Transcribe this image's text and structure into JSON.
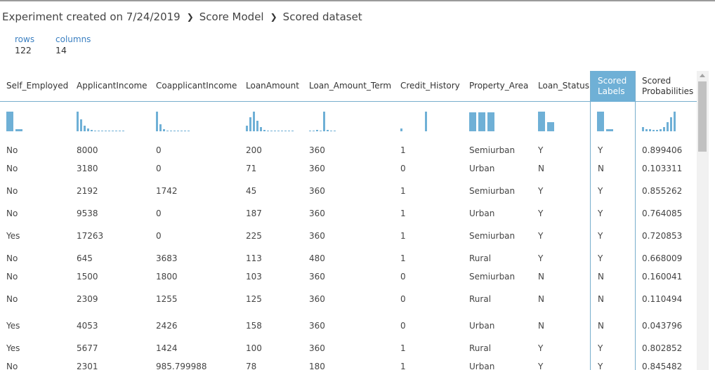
{
  "breadcrumb": {
    "items": [
      "Experiment created on 7/24/2019",
      "Score Model",
      "Scored dataset"
    ],
    "separator_icon": "chevron-right-icon"
  },
  "stats": {
    "rows_label": "rows",
    "rows_value": "122",
    "columns_label": "columns",
    "columns_value": "14"
  },
  "colors": {
    "bar": "#6fb0d6",
    "header_accent": "#78aecd",
    "link": "#3a7fc1"
  },
  "table": {
    "columns": [
      {
        "key": "self_employed",
        "label": "Self_Employed"
      },
      {
        "key": "applicant_income",
        "label": "ApplicantIncome"
      },
      {
        "key": "coapplicant_income",
        "label": "CoapplicantIncome"
      },
      {
        "key": "loan_amount",
        "label": "LoanAmount"
      },
      {
        "key": "loan_amount_term",
        "label": "Loan_Amount_Term"
      },
      {
        "key": "credit_history",
        "label": "Credit_History"
      },
      {
        "key": "property_area",
        "label": "Property_Area"
      },
      {
        "key": "loan_status",
        "label": "Loan_Status"
      },
      {
        "key": "scored_labels",
        "label": "Scored Labels",
        "selected": true
      },
      {
        "key": "scored_probabilities",
        "label": "Scored Probabilities"
      }
    ],
    "histograms": {
      "self_employed": [
        1.0,
        0.12
      ],
      "applicant_income": [
        1.0,
        0.6,
        0.3,
        0.15,
        0.08,
        0.05,
        0.04,
        0.03,
        0.03,
        0.02,
        0.02,
        0.02,
        0.02,
        0.02
      ],
      "coapplicant_income": [
        1.0,
        0.35,
        0.12,
        0.05,
        0.03,
        0.03,
        0.02,
        0.02,
        0.02,
        0.02
      ],
      "loan_amount": [
        0.3,
        0.7,
        1.0,
        0.55,
        0.2,
        0.08,
        0.05,
        0.04,
        0.03,
        0.03,
        0.02,
        0.02,
        0.02,
        0.02
      ],
      "loan_amount_term": [
        0.04,
        0.04,
        0.07,
        0.04,
        1.0,
        0.06,
        0.02,
        0.02
      ],
      "credit_history": [
        0.15,
        1.0
      ],
      "property_area": [
        0.95,
        0.95,
        0.95
      ],
      "loan_status": [
        1.0,
        0.45
      ],
      "scored_labels": [
        1.0,
        0.12
      ],
      "scored_probabilities": [
        0.2,
        0.12,
        0.1,
        0.08,
        0.08,
        0.1,
        0.2,
        0.45,
        0.7,
        1.0
      ]
    },
    "rows": [
      [
        "No",
        "8000",
        "0",
        "200",
        "360",
        "1",
        "Semiurban",
        "Y",
        "Y",
        "0.899406"
      ],
      [
        "No",
        "3180",
        "0",
        "71",
        "360",
        "0",
        "Urban",
        "N",
        "N",
        "0.103311"
      ],
      [
        "No",
        "2192",
        "1742",
        "45",
        "360",
        "1",
        "Semiurban",
        "Y",
        "Y",
        "0.855262"
      ],
      [
        "No",
        "9538",
        "0",
        "187",
        "360",
        "1",
        "Urban",
        "Y",
        "Y",
        "0.764085"
      ],
      [
        "Yes",
        "17263",
        "0",
        "225",
        "360",
        "1",
        "Semiurban",
        "Y",
        "Y",
        "0.720853"
      ],
      [
        "No",
        "645",
        "3683",
        "113",
        "480",
        "1",
        "Rural",
        "Y",
        "Y",
        "0.668009"
      ],
      [
        "No",
        "1500",
        "1800",
        "103",
        "360",
        "0",
        "Semiurban",
        "N",
        "N",
        "0.160041"
      ],
      [
        "No",
        "2309",
        "1255",
        "125",
        "360",
        "0",
        "Rural",
        "N",
        "N",
        "0.110494"
      ],
      [
        "Yes",
        "4053",
        "2426",
        "158",
        "360",
        "0",
        "Urban",
        "N",
        "N",
        "0.043796"
      ],
      [
        "Yes",
        "5677",
        "1424",
        "100",
        "360",
        "1",
        "Rural",
        "Y",
        "Y",
        "0.802852"
      ],
      [
        "No",
        "2301",
        "985.799988",
        "78",
        "180",
        "1",
        "Urban",
        "Y",
        "Y",
        "0.845482"
      ]
    ]
  }
}
